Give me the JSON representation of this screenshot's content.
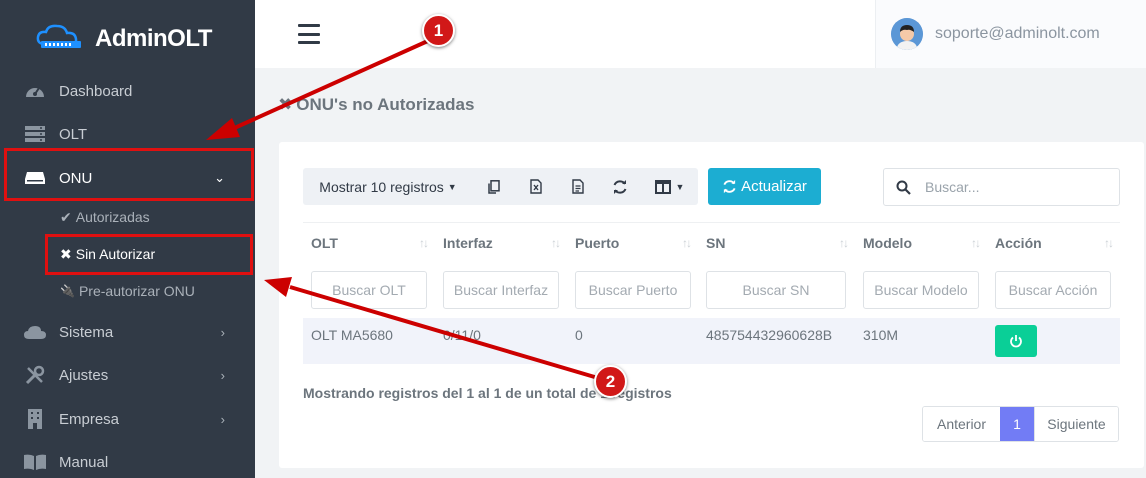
{
  "brand": {
    "name": "AdminOLT"
  },
  "sidebar": {
    "items": [
      {
        "label": "Dashboard",
        "icon": "gauge-icon"
      },
      {
        "label": "OLT",
        "icon": "server-icon"
      },
      {
        "label": "ONU",
        "icon": "router-icon",
        "chevron": "⌄"
      },
      {
        "label": "Sistema",
        "icon": "cloud-icon",
        "chevron": "›"
      },
      {
        "label": "Ajustes",
        "icon": "tools-icon",
        "chevron": "›"
      },
      {
        "label": "Empresa",
        "icon": "building-icon",
        "chevron": "›"
      },
      {
        "label": "Manual",
        "icon": "book-icon"
      }
    ],
    "sub_items": [
      {
        "label": "Autorizadas",
        "glyph": "✔"
      },
      {
        "label": "Sin Autorizar",
        "glyph": "✖"
      },
      {
        "label": "Pre-autorizar ONU",
        "glyph": "🔌"
      }
    ]
  },
  "topbar": {
    "user_email": "soporte@adminolt.com"
  },
  "page": {
    "title": "ONU's no Autorizadas",
    "title_glyph": "✖"
  },
  "toolbar": {
    "show_label": "Mostrar 10 registros",
    "refresh_label": "Actualizar",
    "search_placeholder": "Buscar..."
  },
  "table": {
    "columns": [
      "OLT",
      "Interfaz",
      "Puerto",
      "SN",
      "Modelo",
      "Acción"
    ],
    "filters": [
      "Buscar OLT",
      "Buscar Interfaz",
      "Buscar Puerto",
      "Buscar SN",
      "Buscar Modelo",
      "Buscar Acción"
    ],
    "rows": [
      {
        "olt": "OLT MA5680",
        "interfaz": "0/11/0",
        "puerto": "0",
        "sn": "485754432960628B",
        "modelo": "310M"
      }
    ],
    "info": "Mostrando registros del 1 al 1 de un total de 1 registros"
  },
  "pagination": {
    "prev": "Anterior",
    "current": "1",
    "next": "Siguiente"
  },
  "annotations": {
    "badge1": "1",
    "badge2": "2"
  },
  "colors": {
    "sidebar": "#313a46",
    "accent": "#1cadd2",
    "success": "#0acf97",
    "pager_active": "#727cf5",
    "annotation": "#e01010"
  }
}
